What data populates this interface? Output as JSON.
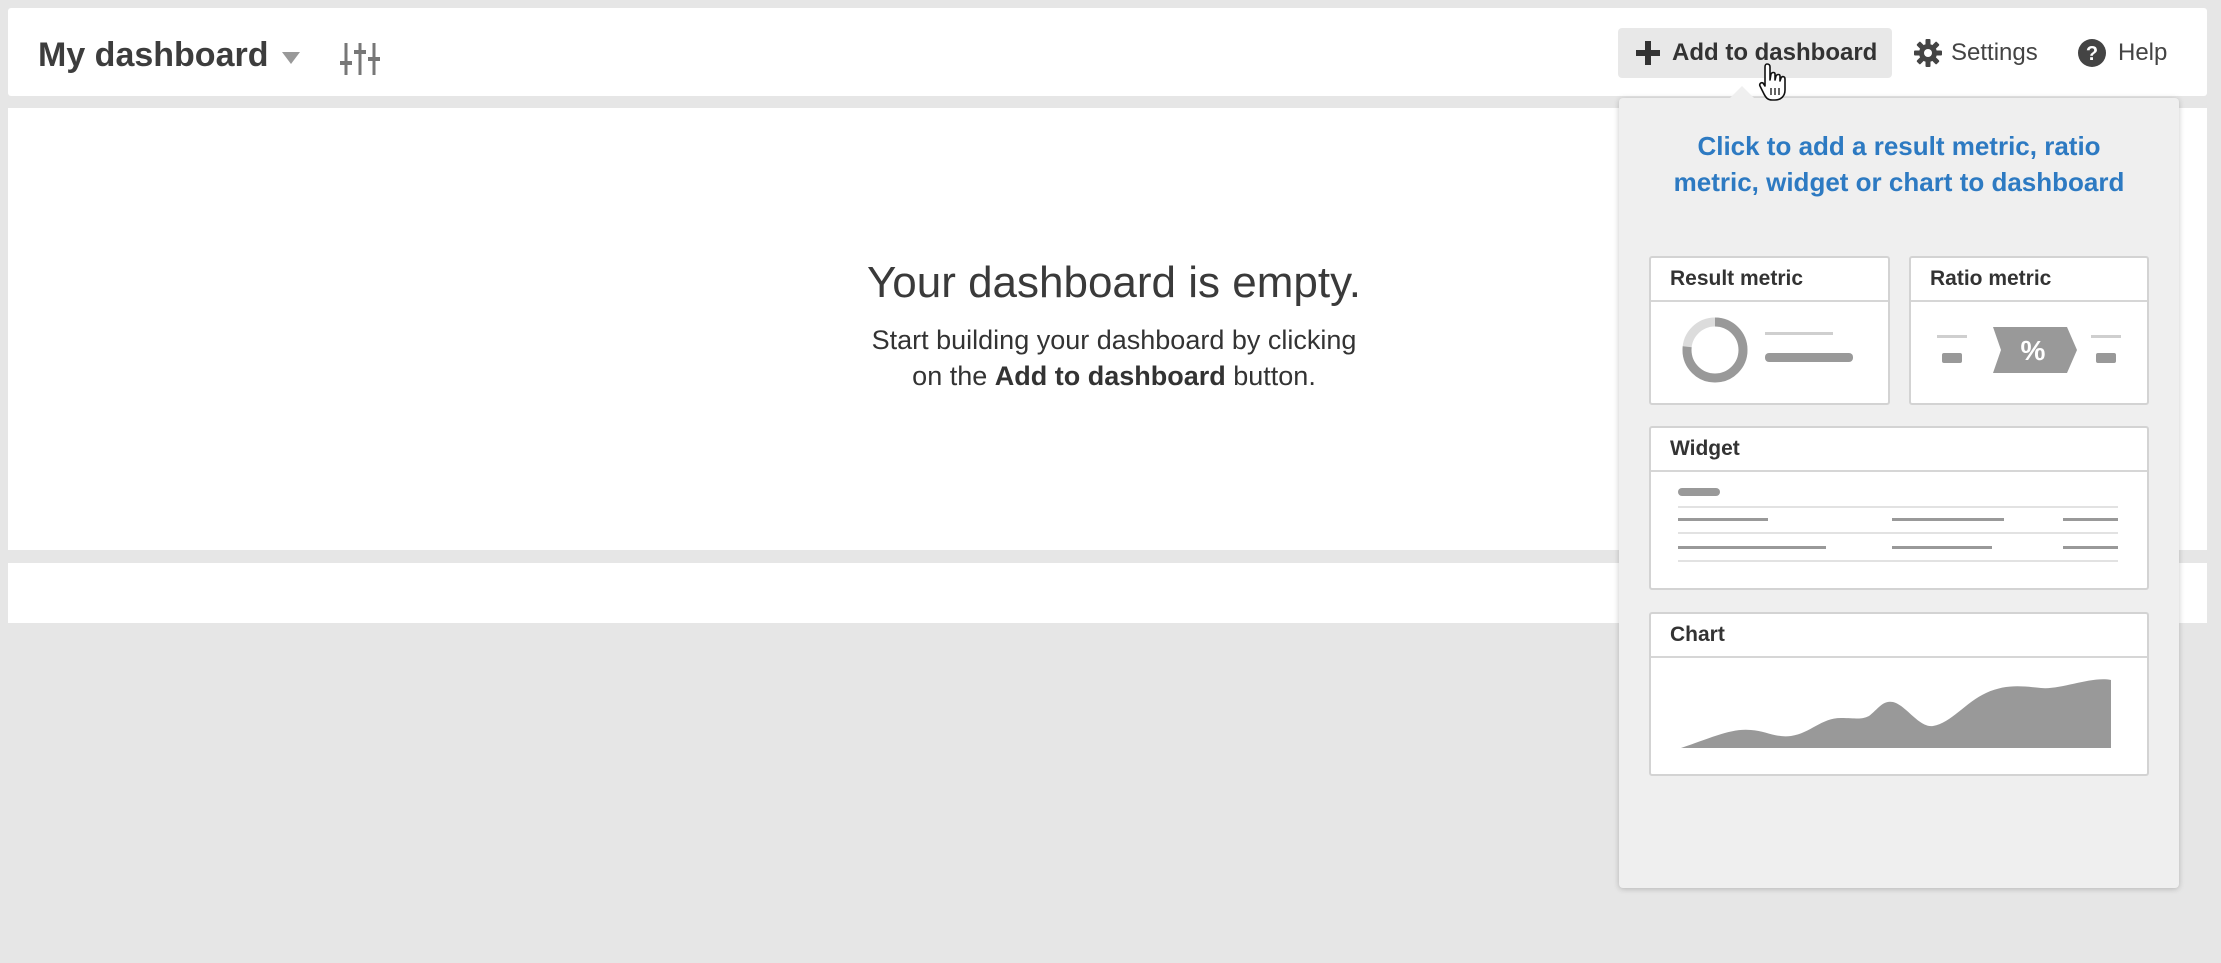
{
  "header": {
    "title": "My dashboard",
    "add_button_label": "Add to dashboard",
    "settings_label": "Settings",
    "help_label": "Help"
  },
  "empty_state": {
    "title": "Your dashboard is empty.",
    "line1": "Start building your dashboard by clicking",
    "line2_prefix": "on the ",
    "line2_bold": "Add to dashboard",
    "line2_suffix": " button."
  },
  "popover": {
    "heading": "Click to add a result metric, ratio metric, widget or chart to dashboard",
    "cards": {
      "result_metric": "Result metric",
      "ratio_metric": "Ratio metric",
      "ratio_symbol": "%",
      "widget": "Widget",
      "chart": "Chart"
    }
  },
  "icons": {
    "title_menu": "chevron-down-icon",
    "customize": "sliders-icon",
    "add": "plus-icon",
    "settings": "gear-icon",
    "help": "help-circle-icon",
    "cursor": "hand-pointer-icon"
  },
  "colors": {
    "accent_blue": "#2d7ac2",
    "placeholder_gray": "#999999",
    "page_bg": "#e6e6e6"
  }
}
